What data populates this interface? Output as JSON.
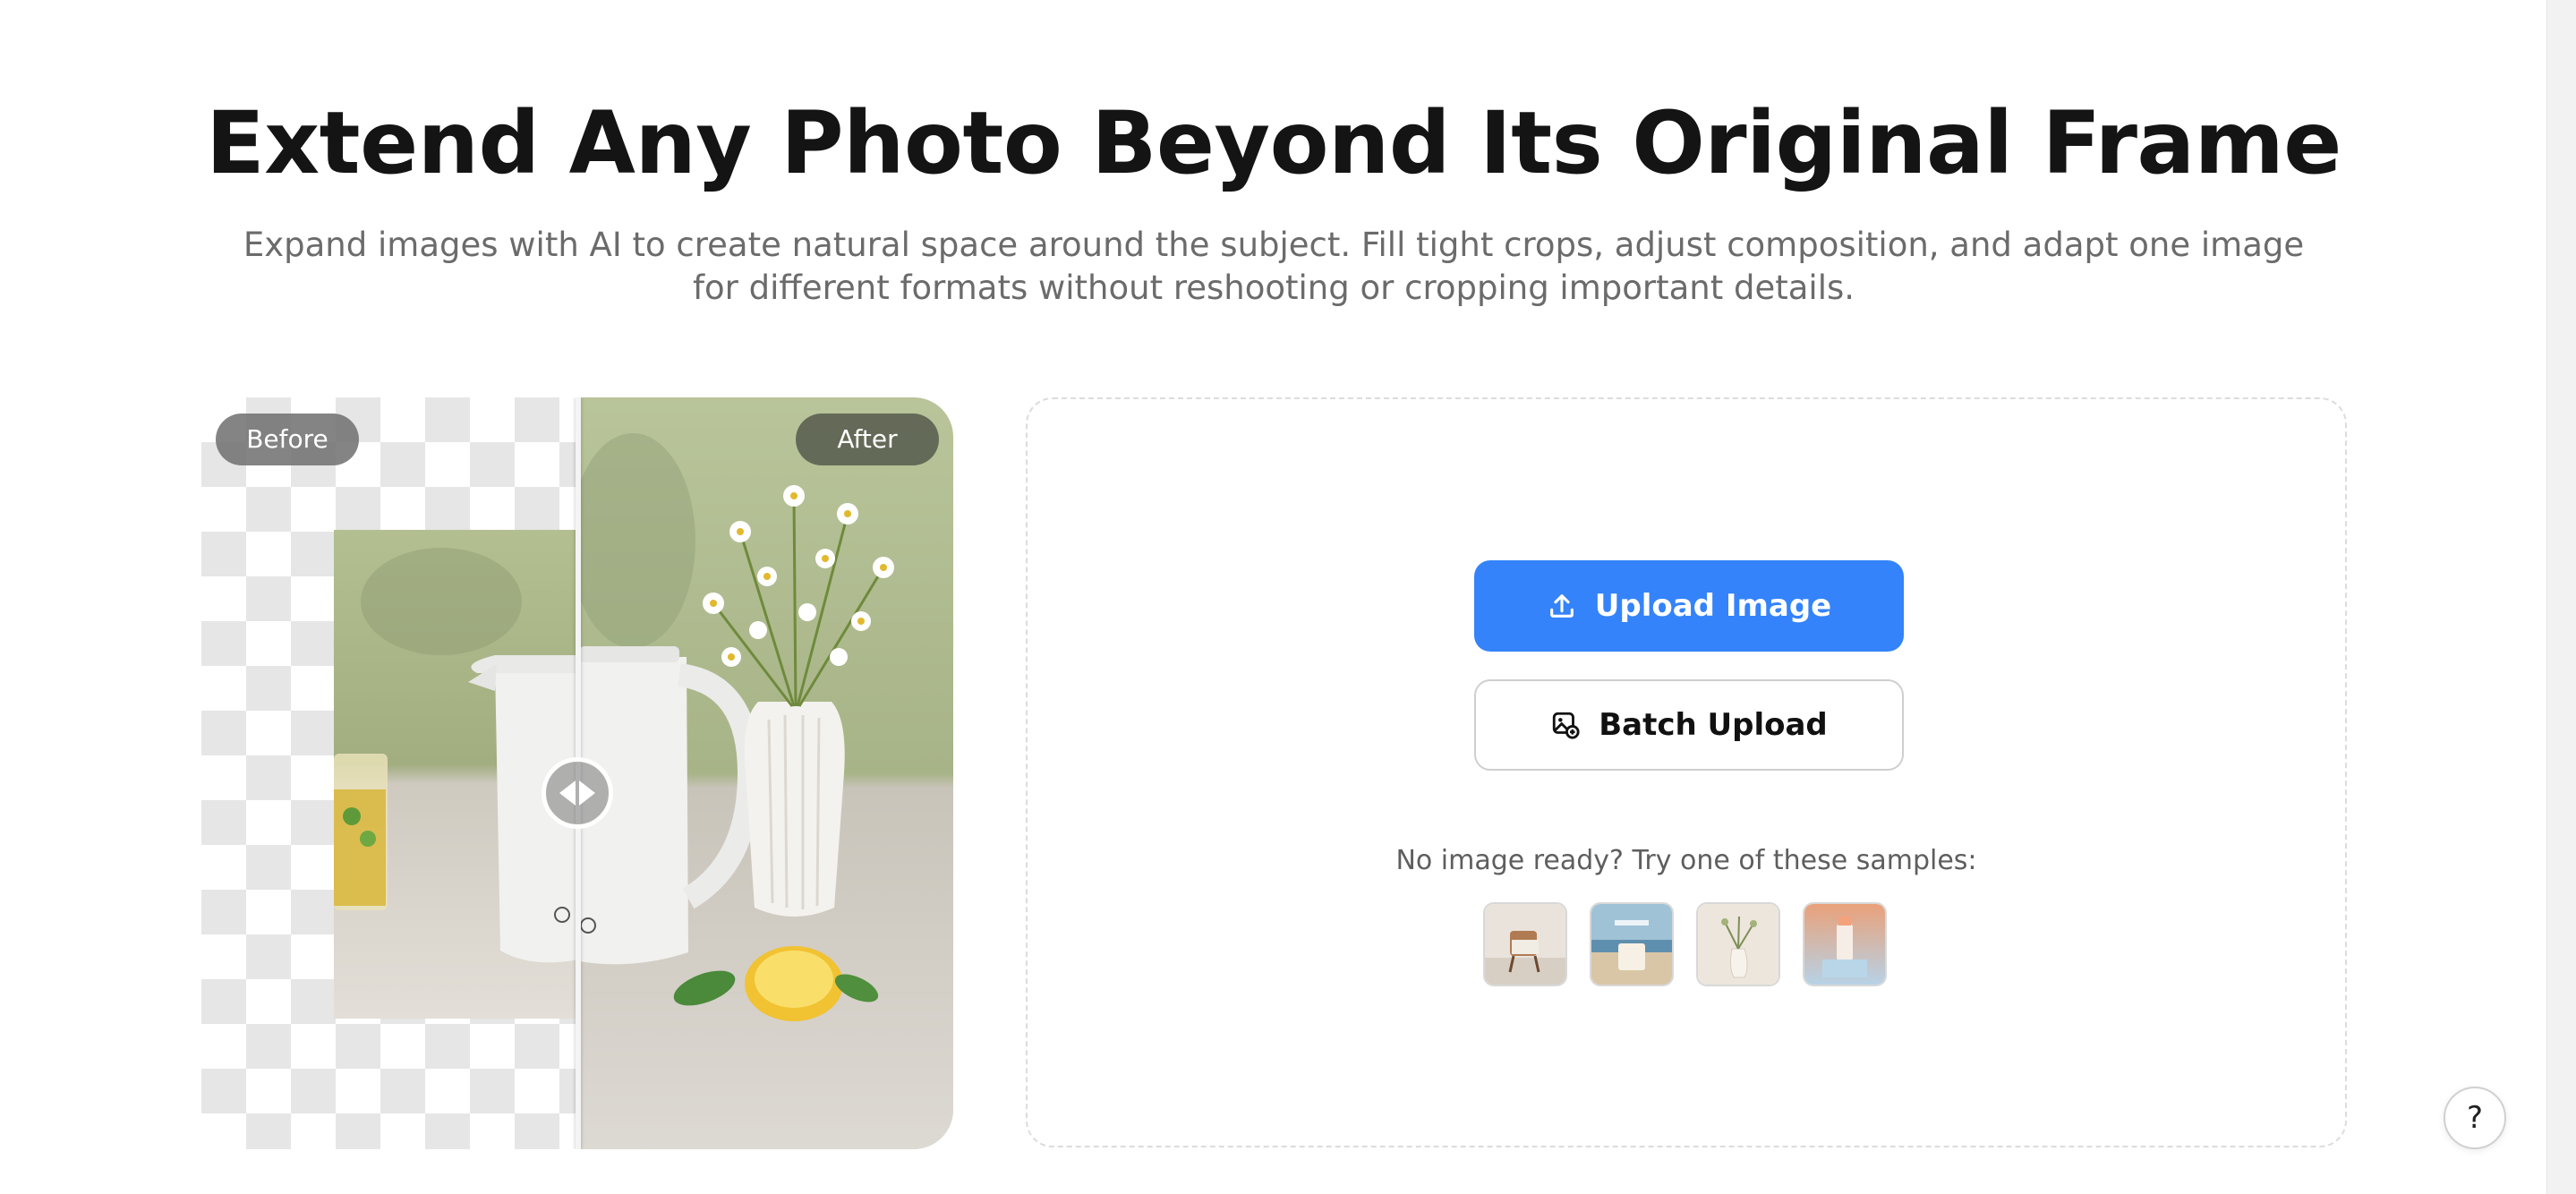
{
  "hero": {
    "title": "Extend Any Photo Beyond Its Original Frame",
    "subtitle": "Expand images with AI to create natural space around the subject. Fill tight crops, adjust composition, and adapt one image for different formats without reshooting or cropping important details."
  },
  "compare": {
    "before_label": "Before",
    "after_label": "After"
  },
  "upload": {
    "upload_label": "Upload Image",
    "batch_label": "Batch Upload",
    "samples_label": "No image ready? Try one of these samples:",
    "samples": [
      "chair-sample",
      "candle-sample",
      "vase-sample",
      "bottle-sample"
    ]
  },
  "help": {
    "label": "?"
  },
  "colors": {
    "primary": "#3483fa",
    "title": "#141414",
    "muted": "#6b6b6b"
  }
}
